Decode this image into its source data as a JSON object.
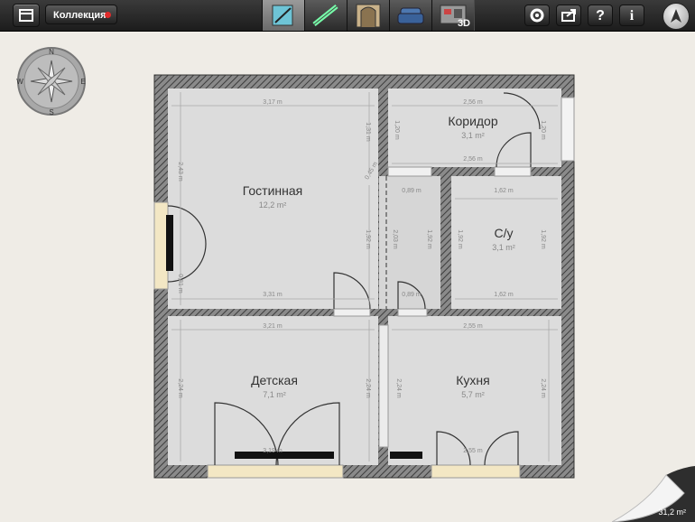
{
  "toolbar": {
    "collection_label": "Коллекция",
    "modes": [
      "draw-walls",
      "measure",
      "doors-windows",
      "furniture",
      "3d-view"
    ],
    "mode_3d_label": "3D",
    "help_label": "?",
    "info_label": "i"
  },
  "compass": {
    "n": "N",
    "s": "S",
    "e": "E",
    "w": "W"
  },
  "rooms": {
    "living": {
      "name": "Гостинная",
      "area": "12,2 m²",
      "dim_top": "3,17 m",
      "dim_right": "1,31 m",
      "dim_left": "2,43 m",
      "dim_bottom": "3,31 m",
      "dim_left_lower": "0,81 m",
      "dim_center": "1,92 m"
    },
    "corridor": {
      "name": "Коридор",
      "area": "3,1 m²",
      "dim_top": "2,56 m",
      "dim_bottom": "2,56 m",
      "dim_left": "1,20 m",
      "dim_right": "1,20 m"
    },
    "bath": {
      "name": "С/у",
      "area": "3,1 m²",
      "dim_top": "1,62 m",
      "dim_bottom": "1,62 m",
      "dim_left": "1,92 m",
      "dim_right": "1,92 m"
    },
    "hall": {
      "dim_top": "0,89 m",
      "dim_bottom": "0,89 m",
      "dim_left": "2,03 m",
      "dim_right": "1,92 m",
      "dim_diag": "0,45 m"
    },
    "kids": {
      "name": "Детская",
      "area": "7,1 m²",
      "dim_top": "3,21 m",
      "dim_bottom": "3,19 m",
      "dim_left": "2,24 m",
      "dim_right": "2,24 m"
    },
    "kitchen": {
      "name": "Кухня",
      "area": "5,7 m²",
      "dim_top": "2,55 m",
      "dim_bottom": "2,55 m",
      "dim_left": "2,24 m",
      "dim_right": "2,24 m"
    }
  },
  "total_area": "31,2 m²",
  "colors": {
    "wall": "#7a7a7a",
    "floor": "#dcdcdc",
    "background": "#efece6",
    "door_arc": "#333333"
  }
}
